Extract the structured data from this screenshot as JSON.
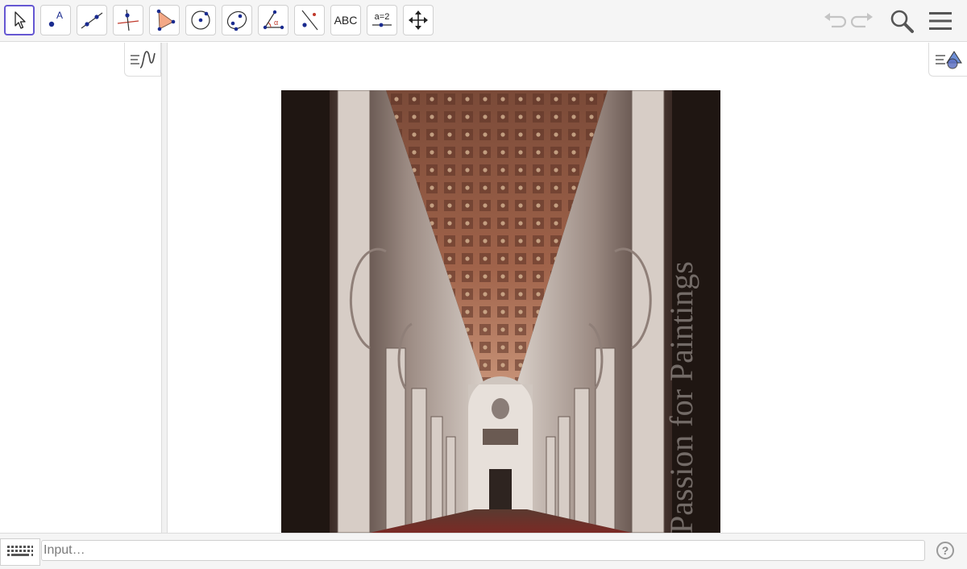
{
  "toolbar": {
    "tools": [
      {
        "name": "Move",
        "icon": "move-arrow-icon",
        "selected": true
      },
      {
        "name": "Point",
        "icon": "point-icon"
      },
      {
        "name": "Line",
        "icon": "line-through-points-icon"
      },
      {
        "name": "Perpendicular Line",
        "icon": "perpendicular-line-icon"
      },
      {
        "name": "Polygon",
        "icon": "polygon-icon"
      },
      {
        "name": "Circle with Center",
        "icon": "circle-center-point-icon"
      },
      {
        "name": "Ellipse",
        "icon": "ellipse-icon"
      },
      {
        "name": "Angle",
        "icon": "angle-icon"
      },
      {
        "name": "Reflect about Line",
        "icon": "reflect-icon"
      },
      {
        "name": "Text",
        "icon": "text-icon",
        "label": "ABC"
      },
      {
        "name": "Slider",
        "icon": "slider-icon",
        "label": "a=2"
      },
      {
        "name": "Move Graphics View",
        "icon": "move-graphics-icon"
      }
    ],
    "undo_icon": "undo-icon",
    "redo_icon": "redo-icon",
    "search_icon": "search-icon",
    "menu_icon": "hamburger-menu-icon"
  },
  "algebra_view": {
    "style_bar_icon": "algebra-style-bar-icon"
  },
  "graphics_view": {
    "style_bar_icon": "graphics-style-bar-icon"
  },
  "image": {
    "icon": "basilica-nave-photo",
    "watermark": "Passion for Paintings"
  },
  "input_bar": {
    "placeholder": "Input…",
    "value": "",
    "keyboard_icon": "keyboard-icon",
    "help_icon": "help-icon",
    "help_label": "?"
  },
  "colors": {
    "accent": "#6557d2",
    "point": "#1a2b8f",
    "toolbar_bg": "#f5f5f5",
    "border": "#dcdcdc"
  }
}
